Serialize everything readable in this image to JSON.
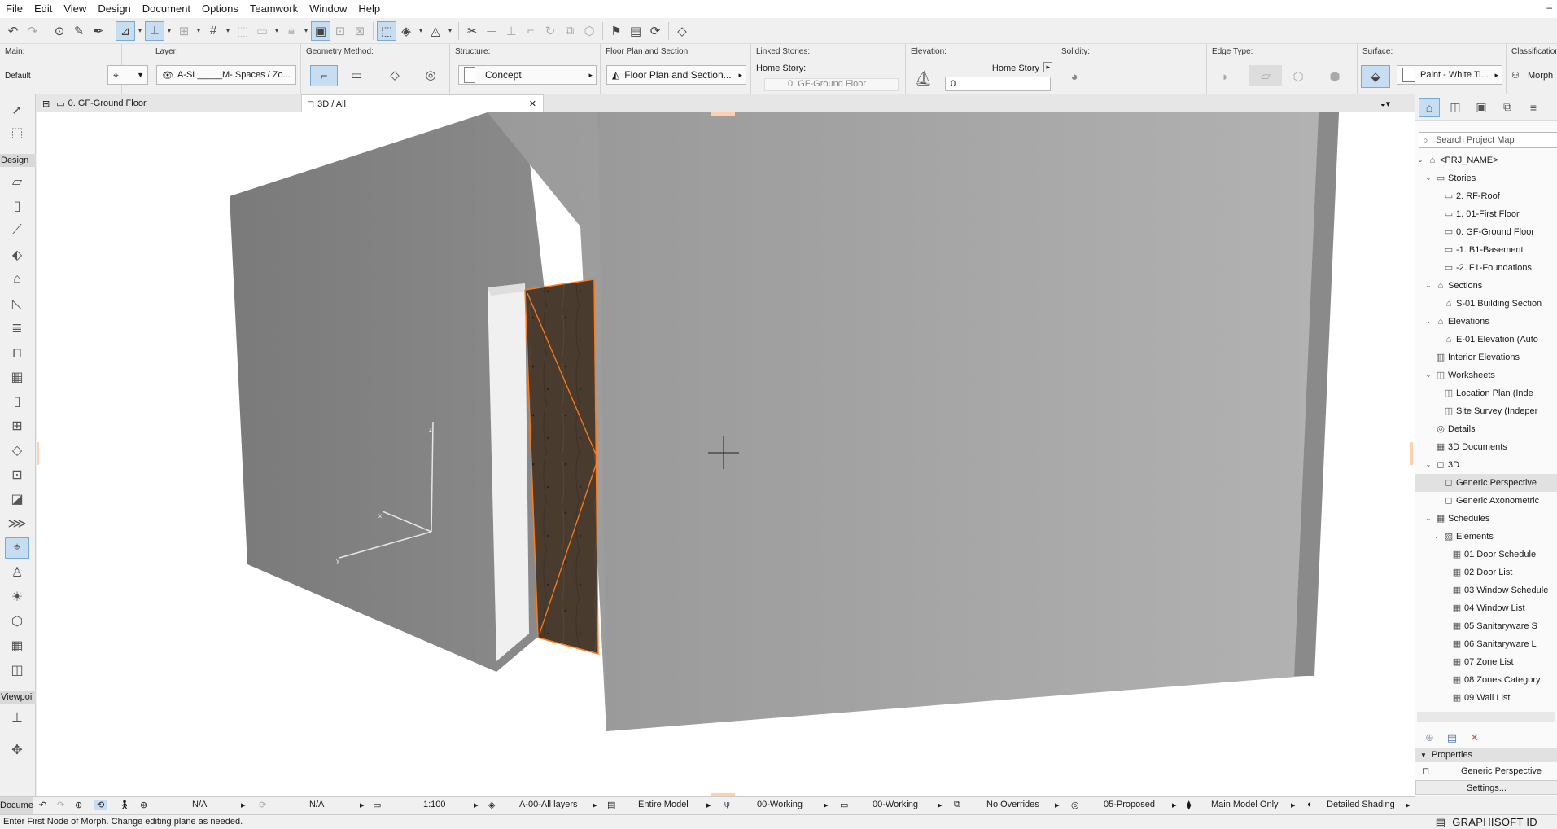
{
  "menu": {
    "items": [
      "File",
      "Edit",
      "View",
      "Design",
      "Document",
      "Options",
      "Teamwork",
      "Window",
      "Help"
    ]
  },
  "infobox": {
    "main": {
      "title": "Main:",
      "value": "Default"
    },
    "layer": {
      "title": "Layer:",
      "value": "A-SL_____M- Spaces / Zo..."
    },
    "geometry": {
      "title": "Geometry Method:"
    },
    "structure": {
      "title": "Structure:",
      "value": "Concept"
    },
    "floorplan": {
      "title": "Floor Plan and Section:",
      "value": "Floor Plan and Section..."
    },
    "linked": {
      "title": "Linked Stories:",
      "home_label": "Home Story:",
      "home_value": "0. GF-Ground Floor"
    },
    "elevation": {
      "title": "Elevation:",
      "ref": "Home Story",
      "value": "0"
    },
    "solidity": {
      "title": "Solidity:"
    },
    "edge": {
      "title": "Edge Type:"
    },
    "surface": {
      "title": "Surface:",
      "value": "Paint - White Ti..."
    },
    "classification": {
      "title": "Classification:",
      "value": "Morph"
    }
  },
  "tabs": {
    "floor": "0. GF-Ground Floor",
    "threed": "3D / All"
  },
  "toolbox": {
    "design_label": "Design",
    "viewpoint_label": "Viewpoi",
    "document_label": "Docume"
  },
  "bottom": {
    "na1": "N/A",
    "na2": "N/A",
    "scale": "1:100",
    "layers": "A-00-All layers",
    "model": "Entire Model",
    "pen1": "00-Working",
    "pen2": "00-Working",
    "overrides": "No Overrides",
    "renovation": "05-Proposed",
    "mvo": "Main Model Only",
    "shading": "Detailed Shading"
  },
  "status": {
    "message": "Enter First Node of Morph. Change editing plane as needed.",
    "brand": "GRAPHISOFT ID"
  },
  "navigator": {
    "search_placeholder": "Search Project Map",
    "tree": [
      {
        "label": "<PRJ_NAME>",
        "level": 0,
        "toggle": "v",
        "icon": "⌂"
      },
      {
        "label": "Stories",
        "level": 1,
        "toggle": "v",
        "icon": "▭"
      },
      {
        "label": "2. RF-Roof",
        "level": 2,
        "toggle": "",
        "icon": "▭"
      },
      {
        "label": "1. 01-First Floor",
        "level": 2,
        "toggle": "",
        "icon": "▭"
      },
      {
        "label": "0. GF-Ground Floor",
        "level": 2,
        "toggle": "",
        "icon": "▭"
      },
      {
        "label": "-1. B1-Basement",
        "level": 2,
        "toggle": "",
        "icon": "▭"
      },
      {
        "label": "-2. F1-Foundations",
        "level": 2,
        "toggle": "",
        "icon": "▭"
      },
      {
        "label": "Sections",
        "level": 1,
        "toggle": "v",
        "icon": "⌂"
      },
      {
        "label": "S-01 Building Section",
        "level": 2,
        "toggle": "",
        "icon": "⌂"
      },
      {
        "label": "Elevations",
        "level": 1,
        "toggle": "v",
        "icon": "⌂"
      },
      {
        "label": "E-01 Elevation (Auto",
        "level": 2,
        "toggle": "",
        "icon": "⌂"
      },
      {
        "label": "Interior Elevations",
        "level": 1,
        "toggle": "",
        "icon": "▥"
      },
      {
        "label": "Worksheets",
        "level": 1,
        "toggle": "v",
        "icon": "◫"
      },
      {
        "label": "Location Plan (Inde",
        "level": 2,
        "toggle": "",
        "icon": "◫"
      },
      {
        "label": "Site Survey (Indeper",
        "level": 2,
        "toggle": "",
        "icon": "◫"
      },
      {
        "label": "Details",
        "level": 1,
        "toggle": "",
        "icon": "◎"
      },
      {
        "label": "3D Documents",
        "level": 1,
        "toggle": "",
        "icon": "▦"
      },
      {
        "label": "3D",
        "level": 1,
        "toggle": "v",
        "icon": "◻"
      },
      {
        "label": "Generic Perspective",
        "level": 2,
        "toggle": "",
        "icon": "◻",
        "selected": true
      },
      {
        "label": "Generic Axonometric",
        "level": 2,
        "toggle": "",
        "icon": "◻"
      },
      {
        "label": "Schedules",
        "level": 1,
        "toggle": "v",
        "icon": "▦"
      },
      {
        "label": "Elements",
        "level": 2,
        "toggle": "v",
        "icon": "▨"
      },
      {
        "label": "01 Door Schedule",
        "level": 3,
        "toggle": "",
        "icon": "▦"
      },
      {
        "label": "02 Door List",
        "level": 3,
        "toggle": "",
        "icon": "▦"
      },
      {
        "label": "03 Window Schedule",
        "level": 3,
        "toggle": "",
        "icon": "▦"
      },
      {
        "label": "04 Window List",
        "level": 3,
        "toggle": "",
        "icon": "▦"
      },
      {
        "label": "05 Sanitaryware S",
        "level": 3,
        "toggle": "",
        "icon": "▦"
      },
      {
        "label": "06 Sanitaryware L",
        "level": 3,
        "toggle": "",
        "icon": "▦"
      },
      {
        "label": "07 Zone List",
        "level": 3,
        "toggle": "",
        "icon": "▦"
      },
      {
        "label": "08 Zones Category",
        "level": 3,
        "toggle": "",
        "icon": "▦"
      },
      {
        "label": "09 Wall List",
        "level": 3,
        "toggle": "",
        "icon": "▦"
      }
    ],
    "properties": {
      "title": "Properties",
      "value": "Generic Perspective",
      "settings": "Settings..."
    }
  },
  "colors": {
    "accent": "#c7ddf2",
    "selection_orange": "#ff7a1a"
  }
}
